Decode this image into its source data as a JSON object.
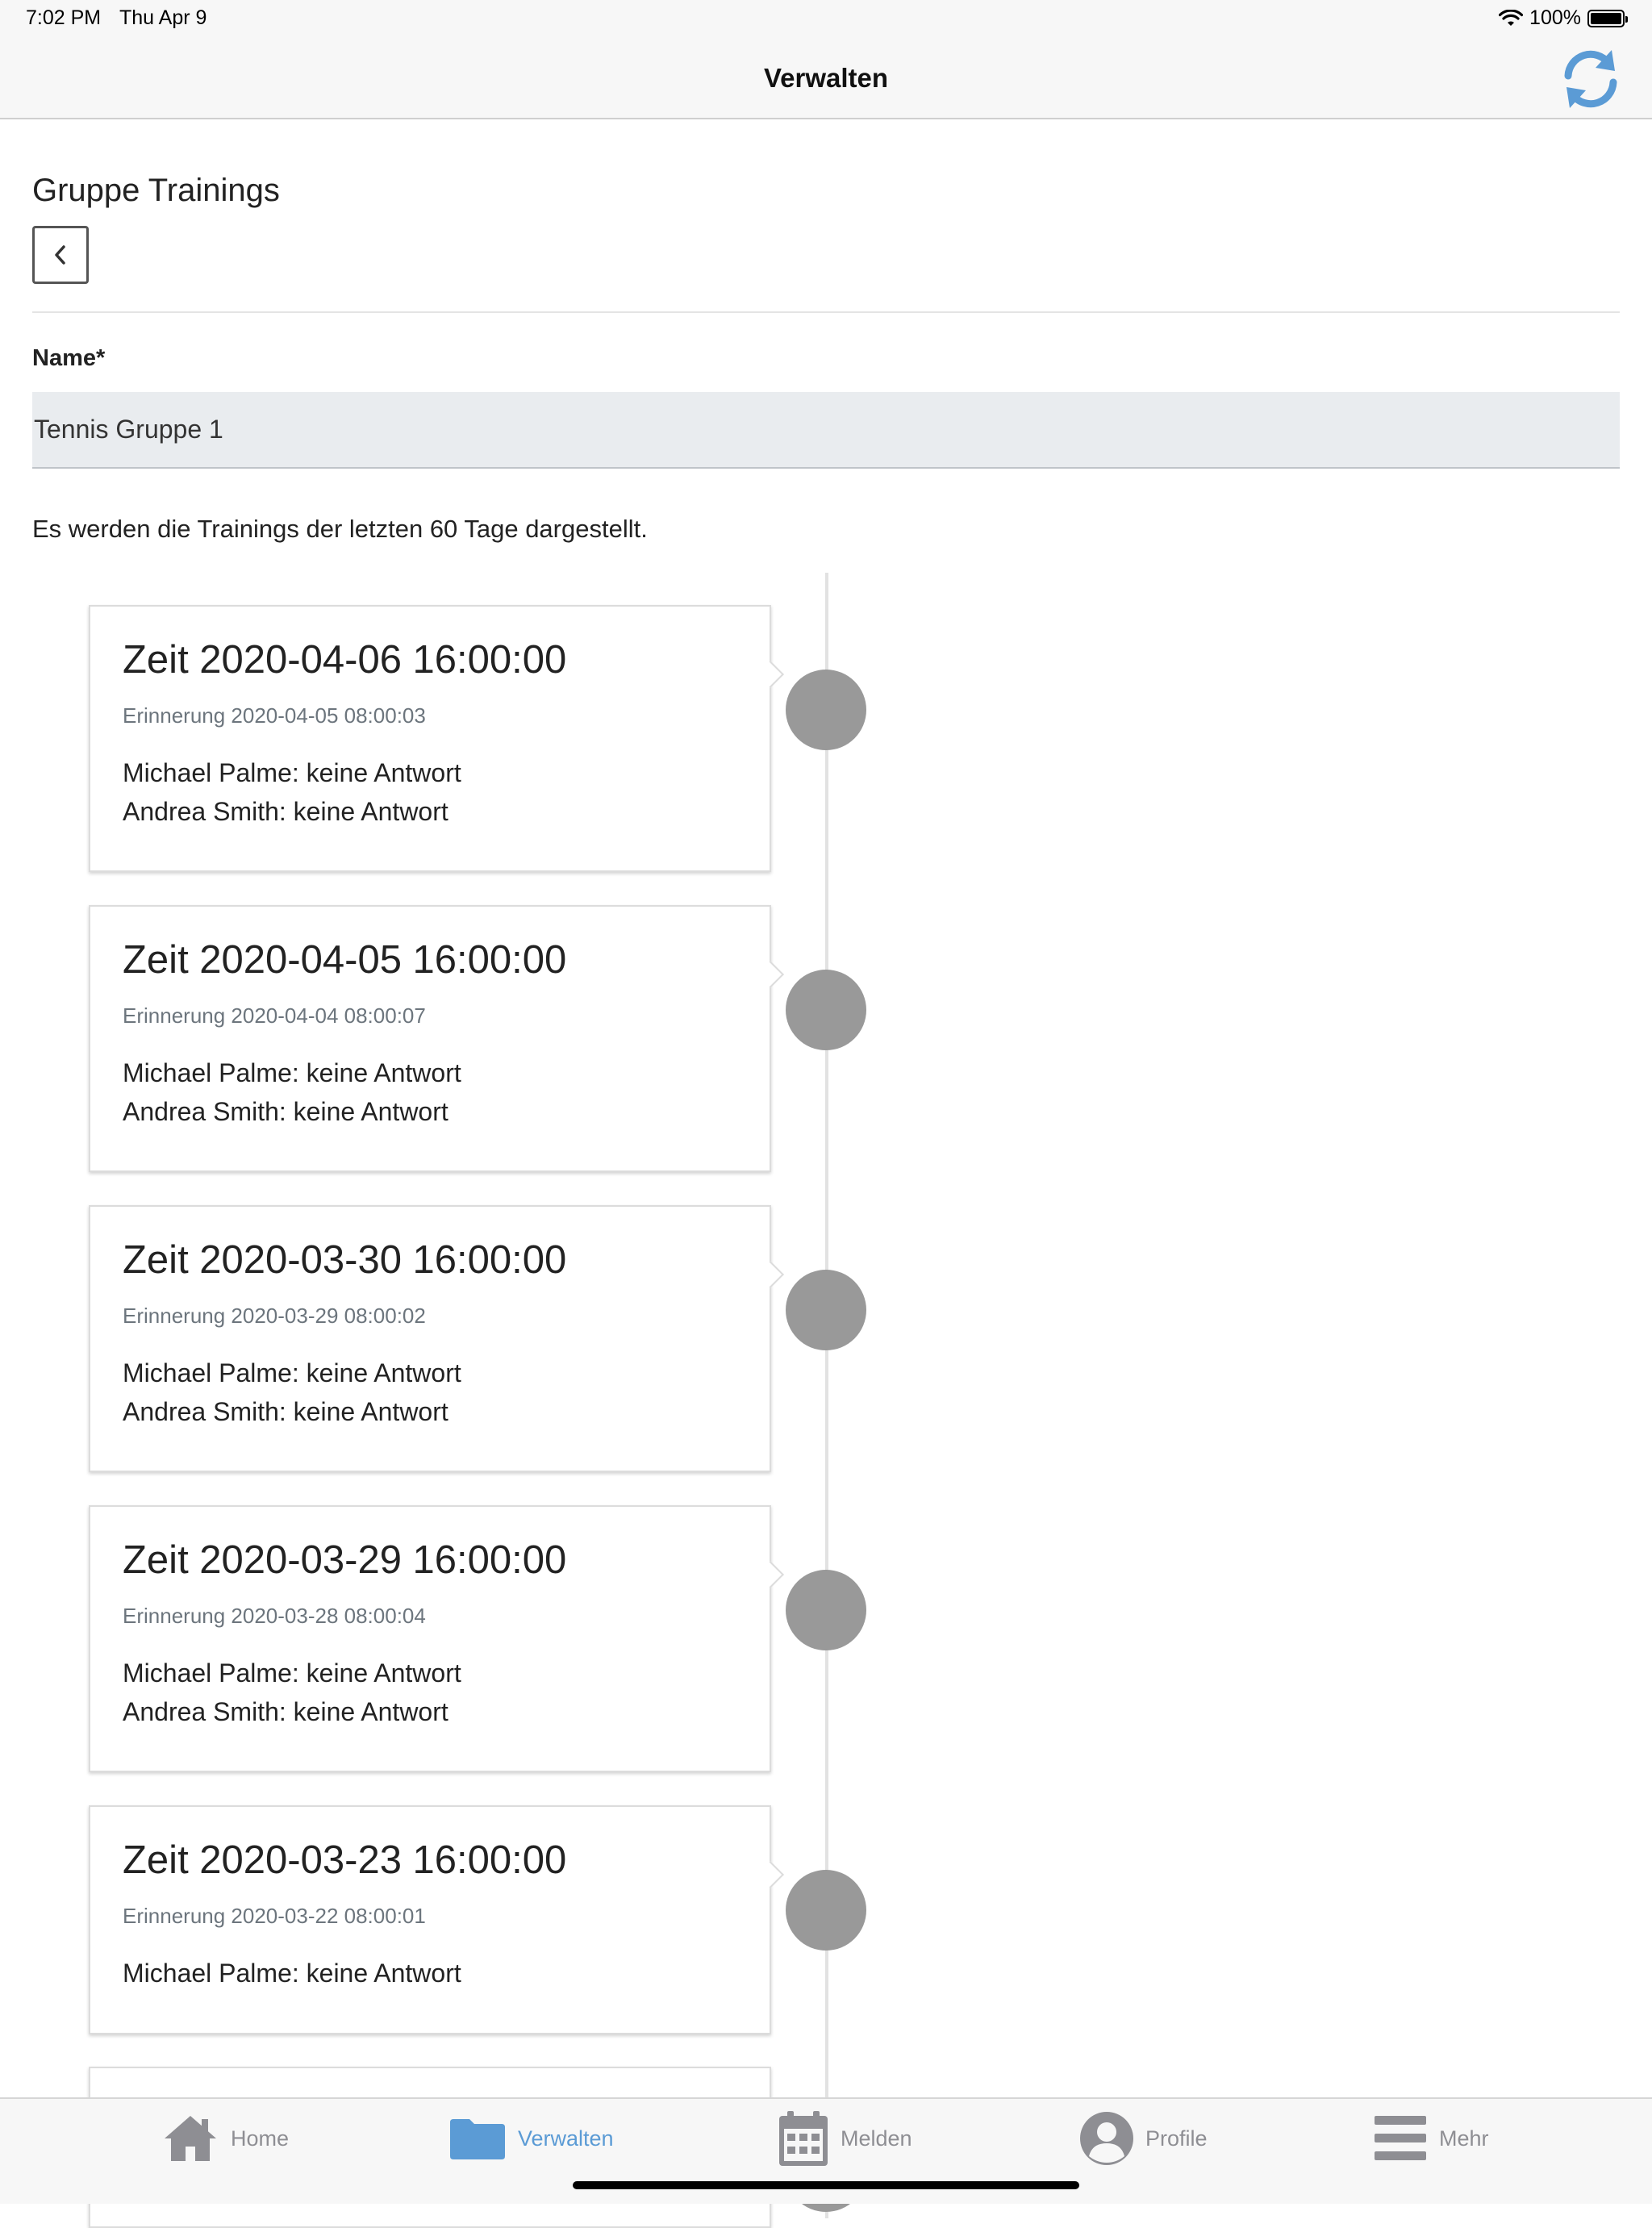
{
  "status": {
    "time": "7:02 PM",
    "date": "Thu Apr 9",
    "battery": "100%"
  },
  "nav": {
    "title": "Verwalten",
    "refresh_icon": "refresh-icon",
    "accent": "#5b9bd5"
  },
  "page": {
    "title": "Gruppe Trainings",
    "name_label": "Name*",
    "name_value": "Tennis Gruppe 1",
    "info": "Es werden die Trainings der letzten 60 Tage dargestellt."
  },
  "trainings": [
    {
      "title": "Zeit 2020-04-06 16:00:00",
      "reminder": "Erinnerung 2020-04-05 08:00:03",
      "lines": [
        "Michael Palme: keine Antwort",
        "Andrea Smith: keine Antwort"
      ]
    },
    {
      "title": "Zeit 2020-04-05 16:00:00",
      "reminder": "Erinnerung 2020-04-04 08:00:07",
      "lines": [
        "Michael Palme: keine Antwort",
        "Andrea Smith: keine Antwort"
      ]
    },
    {
      "title": "Zeit 2020-03-30 16:00:00",
      "reminder": "Erinnerung 2020-03-29 08:00:02",
      "lines": [
        "Michael Palme: keine Antwort",
        "Andrea Smith: keine Antwort"
      ]
    },
    {
      "title": "Zeit 2020-03-29 16:00:00",
      "reminder": "Erinnerung 2020-03-28 08:00:04",
      "lines": [
        "Michael Palme: keine Antwort",
        "Andrea Smith: keine Antwort"
      ]
    },
    {
      "title": "Zeit 2020-03-23 16:00:00",
      "reminder": "Erinnerung 2020-03-22 08:00:01",
      "lines": [
        "Michael Palme: keine Antwort"
      ]
    }
  ],
  "tabs": [
    {
      "label": "Home",
      "icon": "home-icon",
      "active": false
    },
    {
      "label": "Verwalten",
      "icon": "folder-icon",
      "active": true
    },
    {
      "label": "Melden",
      "icon": "calendar-icon",
      "active": false
    },
    {
      "label": "Profile",
      "icon": "user-icon",
      "active": false
    },
    {
      "label": "Mehr",
      "icon": "menu-icon",
      "active": false
    }
  ]
}
